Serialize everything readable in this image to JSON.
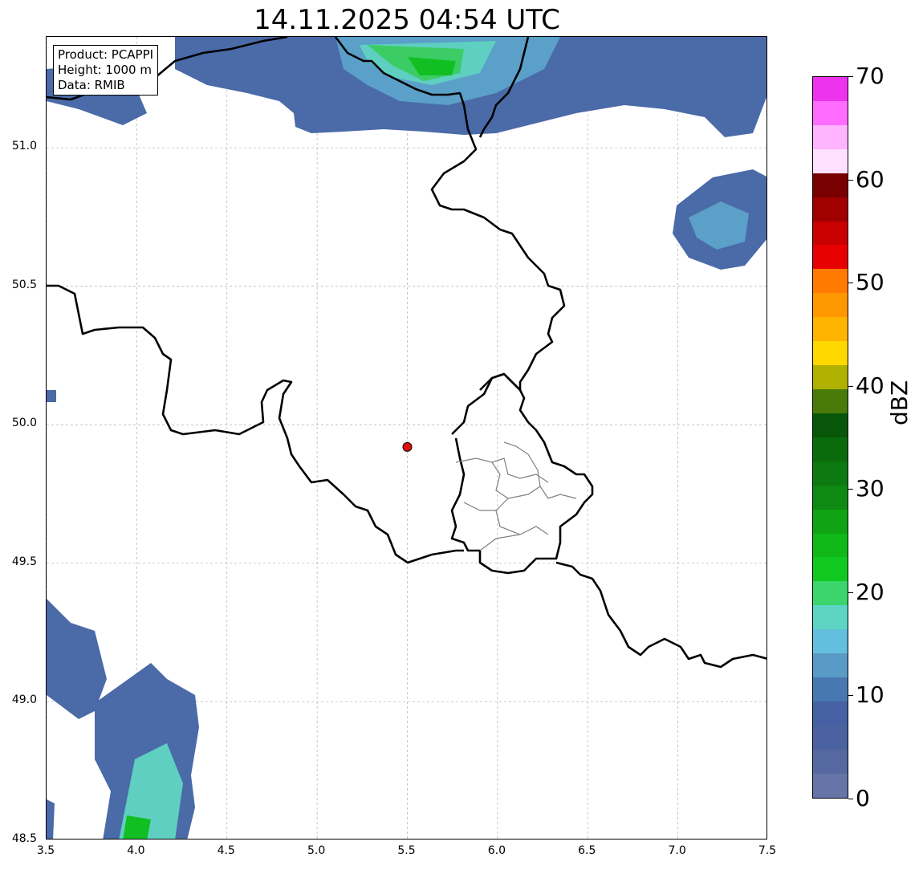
{
  "title": "14.11.2025 04:54 UTC",
  "info": {
    "product": "Product: PCAPPI",
    "height": "Height: 1000 m",
    "data": "Data: RMIB"
  },
  "axes": {
    "xlim": [
      3.5,
      7.5
    ],
    "ylim": [
      48.5,
      51.4
    ],
    "x_ticks": [
      "3.5",
      "4.0",
      "4.5",
      "5.0",
      "5.5",
      "6.0",
      "6.5",
      "7.0",
      "7.5"
    ],
    "y_ticks": [
      "48.5",
      "49.0",
      "49.5",
      "50.0",
      "50.5",
      "51.0"
    ],
    "grid": true
  },
  "radar_site": {
    "lon": 5.5,
    "lat": 49.92,
    "color": "#e01010"
  },
  "colorbar": {
    "label": "dBZ",
    "min": 0,
    "max": 70,
    "tick_labels": [
      "0",
      "10",
      "20",
      "30",
      "40",
      "50",
      "60",
      "70"
    ],
    "step": 2.5,
    "colors": [
      "#6575a8",
      "#5568a0",
      "#4a62a0",
      "#4660a4",
      "#4878b0",
      "#5a9ac6",
      "#64bedd",
      "#5ed4c4",
      "#3cd46c",
      "#10c820",
      "#10b818",
      "#10a414",
      "#0e8a12",
      "#0c7a10",
      "#0a6a0c",
      "#08560a",
      "#4a7a0a",
      "#b0b000",
      "#ffd800",
      "#ffb400",
      "#ff9800",
      "#ff7a00",
      "#e80000",
      "#c80000",
      "#a00000",
      "#780000",
      "#ffe0ff",
      "#ffb4ff",
      "#ff6cff",
      "#ee33ee"
    ]
  }
}
